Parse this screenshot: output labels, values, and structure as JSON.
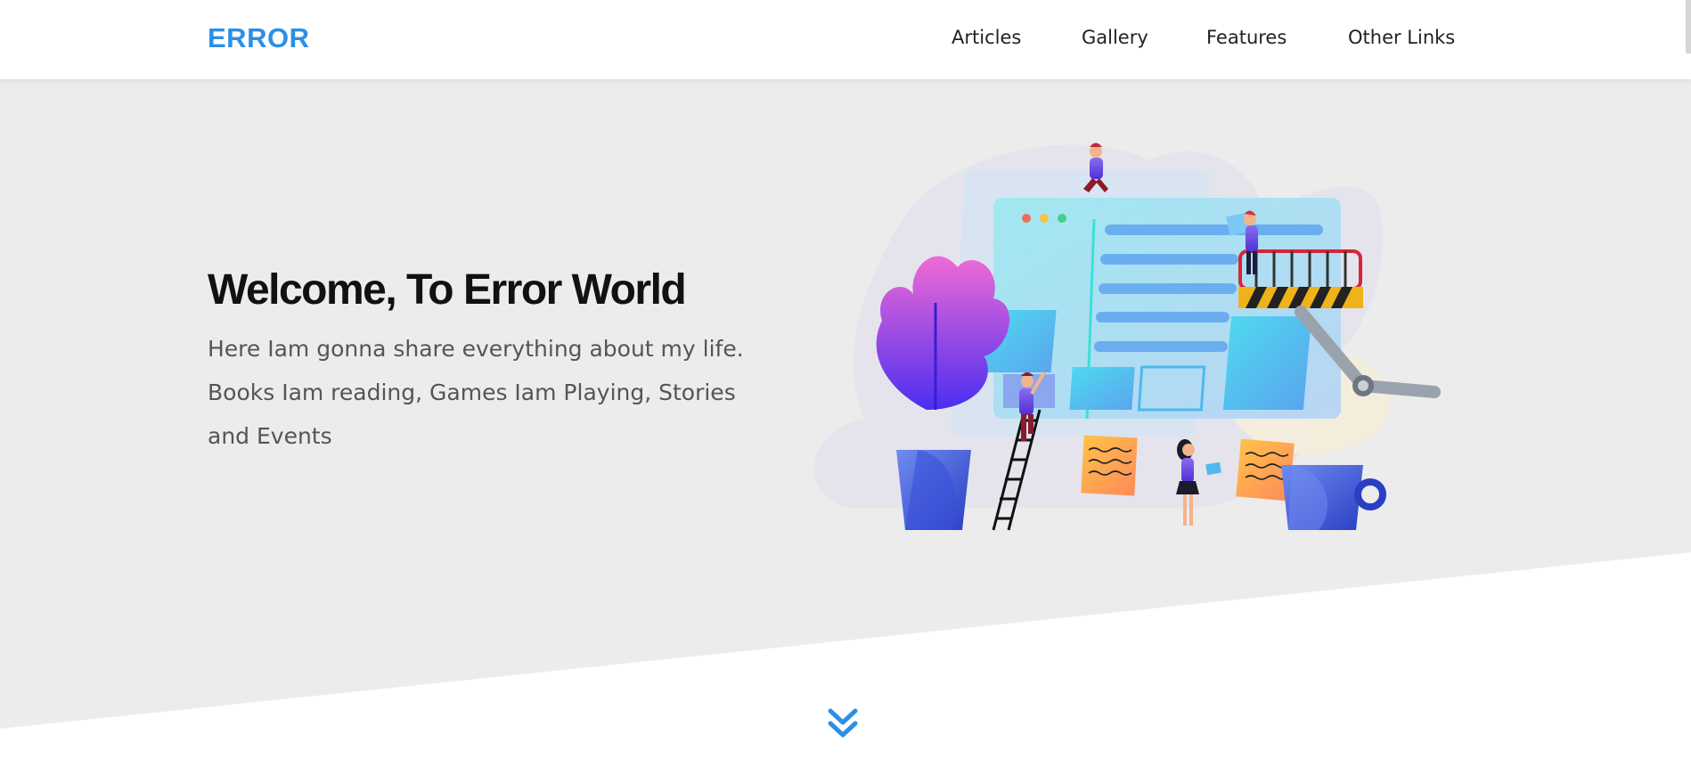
{
  "header": {
    "logo": "ERROR",
    "nav": [
      {
        "label": "Articles"
      },
      {
        "label": "Gallery"
      },
      {
        "label": "Features"
      },
      {
        "label": "Other Links"
      }
    ]
  },
  "hero": {
    "title": "Welcome, To Error World",
    "description": "Here Iam gonna share everything about my life. Books Iam reading, Games Iam Playing, Stories and Events",
    "illustration_icon": "web-building-team-illustration"
  },
  "scroll_down_icon": "double-chevron-down-icon",
  "colors": {
    "brand": "#2c8fe5",
    "hero_background": "#ececec",
    "page_background": "#ffffff"
  }
}
